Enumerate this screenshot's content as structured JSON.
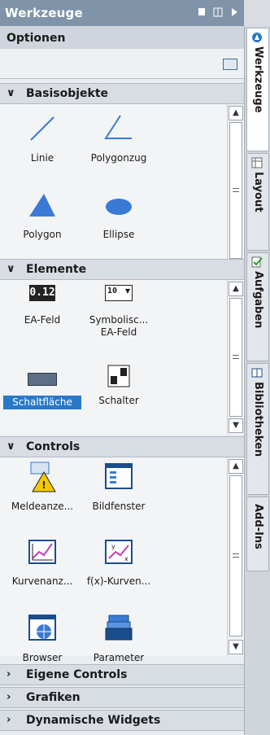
{
  "window": {
    "title": "Werkzeuge"
  },
  "optionen": {
    "label": "Optionen"
  },
  "sections": {
    "basisobjekte": {
      "label": "Basisobjekte",
      "items": [
        {
          "label": "Linie"
        },
        {
          "label": "Polygonzug"
        },
        {
          "label": "Polygon"
        },
        {
          "label": "Ellipse"
        }
      ]
    },
    "elemente": {
      "label": "Elemente",
      "items": [
        {
          "label": "EA-Feld"
        },
        {
          "label": "Symbolisc..."
        },
        {
          "label": "EA-Feld"
        },
        {
          "label": "Schaltfläche"
        },
        {
          "label": "Schalter"
        }
      ]
    },
    "controls": {
      "label": "Controls",
      "items": [
        {
          "label": "Meldeanze..."
        },
        {
          "label": "Bildfenster"
        },
        {
          "label": "Kurvenanz..."
        },
        {
          "label": "f(x)-Kurven..."
        },
        {
          "label": "Browser"
        },
        {
          "label": "Parameter"
        }
      ]
    },
    "eigene": {
      "label": "Eigene Controls"
    },
    "grafiken": {
      "label": "Grafiken"
    },
    "widgets": {
      "label": "Dynamische Widgets"
    }
  },
  "icon_texts": {
    "ea_feld": "0.12",
    "symbolic": "10"
  },
  "chevrons": {
    "expanded": "∨",
    "collapsed": "›"
  },
  "tabs": [
    {
      "label": "Werkzeuge",
      "icon": "tools-icon"
    },
    {
      "label": "Layout",
      "icon": "layout-icon"
    },
    {
      "label": "Aufgaben",
      "icon": "tasks-icon"
    },
    {
      "label": "Bibliotheken",
      "icon": "library-icon"
    },
    {
      "label": "Add-Ins",
      "icon": "addins-icon"
    }
  ],
  "colors": {
    "titlebar": "#7f93a9",
    "selection": "#2a78c8",
    "shape_fill": "#3a7ad6"
  }
}
